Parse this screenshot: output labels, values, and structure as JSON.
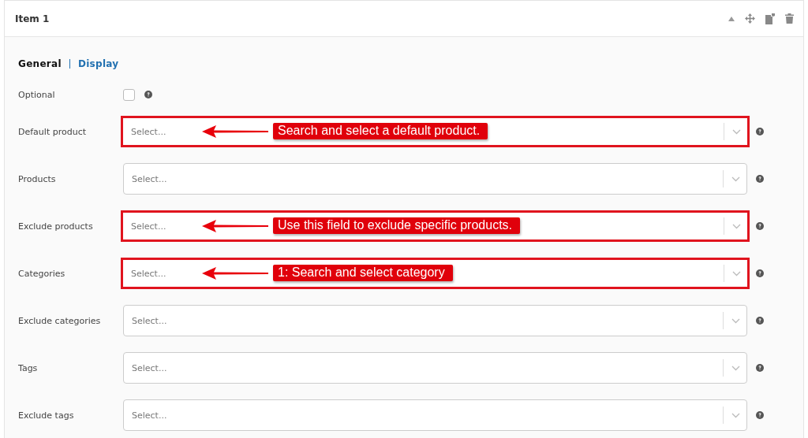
{
  "panel": {
    "title": "Item 1"
  },
  "tabs": [
    {
      "label": "General",
      "selected": true
    },
    {
      "label": "Display",
      "selected": false
    }
  ],
  "fields": [
    {
      "kind": "checkbox",
      "label": "Optional",
      "checked": false
    },
    {
      "kind": "select",
      "label": "Default product",
      "placeholder": "Select...",
      "annotation": "Search and select a default product."
    },
    {
      "kind": "select",
      "label": "Products",
      "placeholder": "Select..."
    },
    {
      "kind": "select",
      "label": "Exclude products",
      "placeholder": "Select...",
      "annotation": "Use this field to exclude specific products."
    },
    {
      "kind": "select",
      "label": "Categories",
      "placeholder": "Select...",
      "annotation": "1: Search and select category"
    },
    {
      "kind": "select",
      "label": "Exclude categories",
      "placeholder": "Select..."
    },
    {
      "kind": "select",
      "label": "Tags",
      "placeholder": "Select..."
    },
    {
      "kind": "select",
      "label": "Exclude tags",
      "placeholder": "Select..."
    }
  ]
}
